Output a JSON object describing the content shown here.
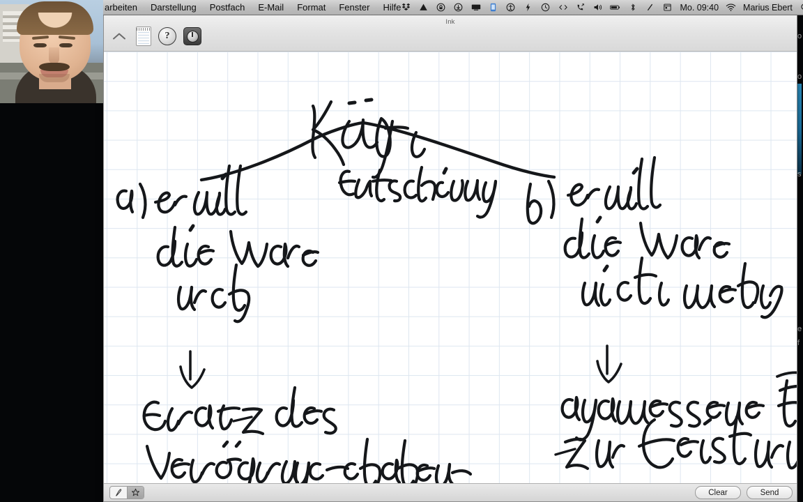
{
  "menubar": {
    "items": [
      {
        "label": "arbeiten",
        "name": "menu-bearbeiten"
      },
      {
        "label": "Darstellung",
        "name": "menu-darstellung"
      },
      {
        "label": "Postfach",
        "name": "menu-postfach"
      },
      {
        "label": "E-Mail",
        "name": "menu-email"
      },
      {
        "label": "Format",
        "name": "menu-format"
      },
      {
        "label": "Fenster",
        "name": "menu-fenster"
      },
      {
        "label": "Hilfe",
        "name": "menu-hilfe"
      }
    ],
    "status_icons": [
      {
        "name": "dropbox-icon",
        "glyph": "❖"
      },
      {
        "name": "google-drive-icon",
        "glyph": "▲"
      },
      {
        "name": "lock-icon",
        "glyph": "Ⓐ"
      },
      {
        "name": "download-icon",
        "glyph": "Ⓔ"
      },
      {
        "name": "display-icon",
        "glyph": "▬"
      },
      {
        "name": "phone-sync-icon",
        "glyph": "▯"
      },
      {
        "name": "accessibility-icon",
        "glyph": "Ⓙ"
      },
      {
        "name": "flash-icon",
        "glyph": "⚡"
      },
      {
        "name": "timemachine-icon",
        "glyph": "↺"
      },
      {
        "name": "code-icon",
        "glyph": "‹›"
      },
      {
        "name": "telephone-icon",
        "glyph": "☎"
      },
      {
        "name": "volume-icon",
        "glyph": "🔊"
      },
      {
        "name": "battery-icon",
        "glyph": "▭"
      },
      {
        "name": "bluetooth-icon",
        "glyph": "ᛦ"
      },
      {
        "name": "pen-icon",
        "glyph": "╱"
      },
      {
        "name": "calendar-icon",
        "glyph": "▤"
      }
    ],
    "clock": "Mo. 09:40",
    "wifi_icon": "wifi-icon",
    "username": "Marius Ebert",
    "search_icon": "search-icon",
    "notification_icon": "notification-center-icon"
  },
  "window": {
    "title": "Ink",
    "toolbar": [
      {
        "name": "collapse-button",
        "label": "chevron-up-icon"
      },
      {
        "name": "notepad-button",
        "label": "notepad-icon"
      },
      {
        "name": "help-button",
        "label": "?"
      },
      {
        "name": "preferences-button",
        "label": "preferences-icon"
      }
    ]
  },
  "bottombar": {
    "mode_pen_icon": "pen-mode-icon",
    "mode_pen_glyph": "Å",
    "mode_star_icon": "star-mode-icon",
    "mode_star_glyph": "☆",
    "clear_label": "Clear",
    "send_label": "Send"
  },
  "handwriting": {
    "title": "Käufer",
    "branch_label": "Entscheidung",
    "left_branch": {
      "marker": "a)",
      "line1": "er will",
      "line2": "die Ware",
      "line3": "noch",
      "arrow": "down-arrow",
      "result_line1": "Ersatz des",
      "result_line2": "Verzögerungsschadens"
    },
    "right_branch": {
      "marker": "b)",
      "line1": "er will",
      "line2": "die Ware",
      "line3": "nicht mehr",
      "arrow": "down-arrow",
      "result_line1": "angemessene Frist",
      "result_line2": "zur Leistung"
    }
  },
  "webcam": {
    "name": "webcam-overlay",
    "subject": "presenter-portrait"
  },
  "colors": {
    "ink": "#15171a",
    "grid_line": "#dde6f0",
    "canvas_bg": "#ffffff",
    "menubar_bg": "#c4c4c4",
    "window_chrome": "#e6e6e6",
    "desktop_bg": "#050608",
    "accent_blue": "#2f9fd6"
  }
}
